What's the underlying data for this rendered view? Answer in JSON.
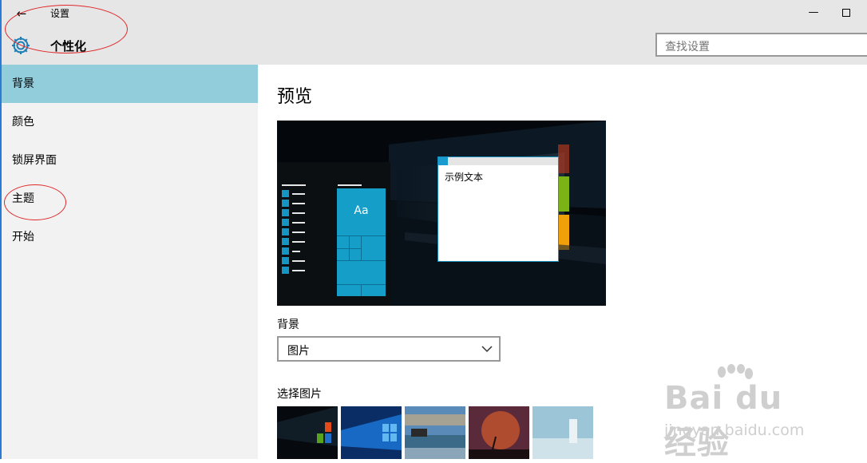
{
  "titlebar": {
    "back_label": "←",
    "app_title": "设置",
    "section_title": "个性化",
    "minimize_label": "—"
  },
  "search": {
    "placeholder": "查找设置"
  },
  "sidebar": {
    "items": [
      {
        "label": "背景",
        "active": true
      },
      {
        "label": "颜色"
      },
      {
        "label": "锁屏界面"
      },
      {
        "label": "主题"
      },
      {
        "label": "开始"
      }
    ]
  },
  "main": {
    "preview_title": "预览",
    "preview": {
      "tile_label": "Aa",
      "sample_text": "示例文本"
    },
    "background_label": "背景",
    "background_value": "图片",
    "choose_label": "选择图片"
  },
  "watermark": {
    "brand": "Bai du 经验",
    "url": "jingyan.baidu.com"
  },
  "colors": {
    "accent": "#92cddc",
    "tile": "#149ec8",
    "annotation": "#e0282a",
    "border": "#2b7bd4"
  }
}
